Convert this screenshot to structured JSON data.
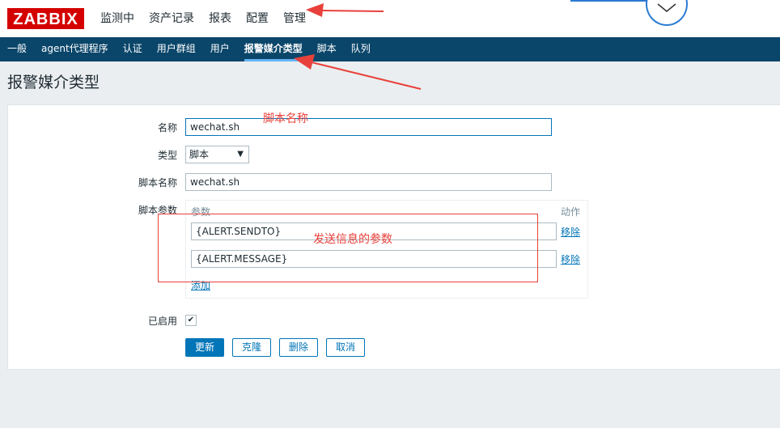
{
  "header": {
    "logo": "ZABBIX",
    "menu": [
      "监测中",
      "资产记录",
      "报表",
      "配置",
      "管理"
    ],
    "active_menu": "管理"
  },
  "subnav": {
    "items": [
      "一般",
      "agent代理程序",
      "认证",
      "用户群组",
      "用户",
      "报警媒介类型",
      "脚本",
      "队列"
    ],
    "active": "报警媒介类型"
  },
  "page": {
    "title": "报警媒介类型"
  },
  "form": {
    "name_label": "名称",
    "name_value": "wechat.sh",
    "type_label": "类型",
    "type_value": "脚本",
    "script_label": "脚本名称",
    "script_value": "wechat.sh",
    "params_label": "脚本参数",
    "params_col_param": "参数",
    "params_col_action": "动作",
    "params": [
      {
        "value": "{ALERT.SENDTO}",
        "action": "移除"
      },
      {
        "value": "{ALERT.MESSAGE}",
        "action": "移除"
      }
    ],
    "add_link": "添加",
    "enabled_label": "已启用",
    "enabled": true
  },
  "buttons": {
    "update": "更新",
    "clone": "克隆",
    "delete": "删除",
    "cancel": "取消"
  },
  "annotations": {
    "script_name_note": "脚本名称",
    "params_note": "发送信息的参数",
    "color": "#e8413b"
  },
  "colors": {
    "brand": "#d40000",
    "subnav_bg": "#0a466a",
    "accent": "#0275b8"
  }
}
